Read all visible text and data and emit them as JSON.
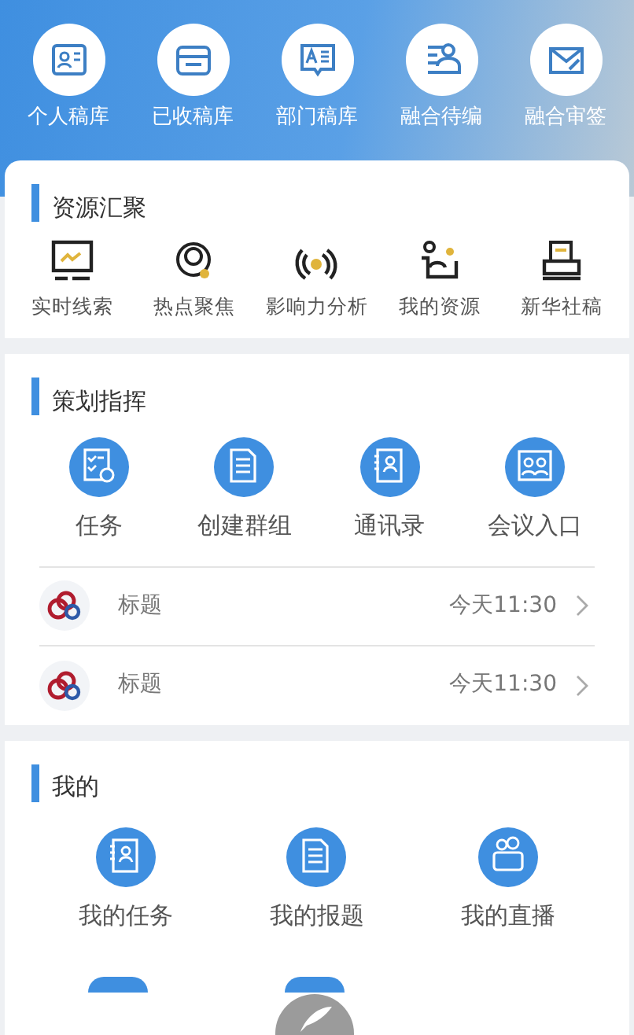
{
  "top_shortcuts": [
    {
      "label": "个人稿库"
    },
    {
      "label": "已收稿库"
    },
    {
      "label": "部门稿库"
    },
    {
      "label": "融合待编"
    },
    {
      "label": "融合审签"
    }
  ],
  "resources": {
    "title": "资源汇聚",
    "items": [
      {
        "label": "实时线索"
      },
      {
        "label": "热点聚焦"
      },
      {
        "label": "影响力分析"
      },
      {
        "label": "我的资源"
      },
      {
        "label": "新华社稿"
      }
    ]
  },
  "planning": {
    "title": "策划指挥",
    "items": [
      {
        "label": "任务"
      },
      {
        "label": "创建群组"
      },
      {
        "label": "通讯录"
      },
      {
        "label": "会议入口"
      }
    ],
    "rows": [
      {
        "title": "标题",
        "time": "今天11:30"
      },
      {
        "title": "标题",
        "time": "今天11:30"
      }
    ]
  },
  "mine": {
    "title": "我的",
    "items": [
      {
        "label": "我的任务"
      },
      {
        "label": "我的报题"
      },
      {
        "label": "我的直播"
      }
    ]
  }
}
